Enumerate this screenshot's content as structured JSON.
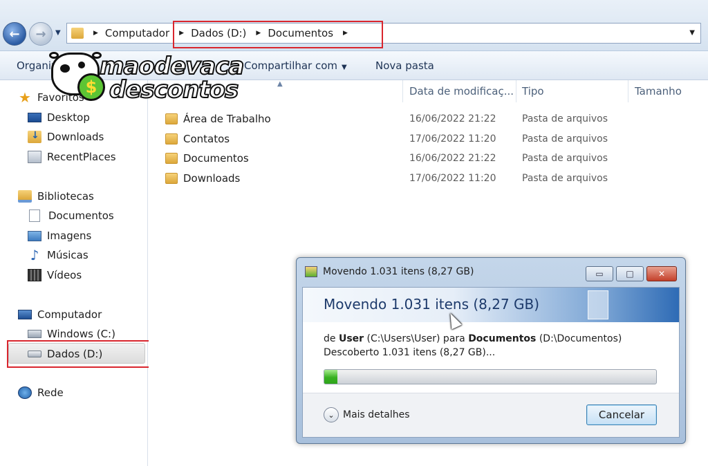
{
  "window": {
    "breadcrumb": [
      "Computador",
      "Dados (D:)",
      "Documentos"
    ]
  },
  "toolbar": {
    "organize": "Organizar",
    "share": "Compartilhar com",
    "new_folder": "Nova pasta"
  },
  "logo": {
    "line1": "maodevaca",
    "line2": "descontos"
  },
  "sidebar": {
    "favorites": "Favoritos",
    "favorites_items": [
      "Desktop",
      "Downloads",
      "RecentPlaces"
    ],
    "libraries": "Bibliotecas",
    "libraries_items": [
      "Documentos",
      "Imagens",
      "Músicas",
      "Vídeos"
    ],
    "computer": "Computador",
    "computer_items": [
      "Windows (C:)",
      "Dados (D:)"
    ],
    "network": "Rede"
  },
  "columns": {
    "date": "Data de modificaç...",
    "type": "Tipo",
    "size": "Tamanho"
  },
  "files": [
    {
      "name": "Área de Trabalho",
      "date": "16/06/2022 21:22",
      "type": "Pasta de arquivos"
    },
    {
      "name": "Contatos",
      "date": "17/06/2022 11:20",
      "type": "Pasta de arquivos"
    },
    {
      "name": "Documentos",
      "date": "16/06/2022 21:22",
      "type": "Pasta de arquivos"
    },
    {
      "name": "Downloads",
      "date": "17/06/2022 11:20",
      "type": "Pasta de arquivos"
    }
  ],
  "dialog": {
    "title": "Movendo 1.031 itens (8,27 GB)",
    "heading": "Movendo 1.031 itens (8,27 GB)",
    "from_prefix": "de ",
    "from_user": "User",
    "from_path": " (C:\\Users\\User) para ",
    "to_name": "Documentos",
    "to_path": " (D:\\Documentos)",
    "status": "Descoberto 1.031 itens (8,27 GB)...",
    "progress_percent": 4,
    "more_details": "Mais detalhes",
    "cancel": "Cancelar",
    "minimize": "▭",
    "maximize": "□",
    "close": "✕"
  },
  "colors": {
    "highlight": "#d9252d",
    "progress": "#38b021"
  }
}
